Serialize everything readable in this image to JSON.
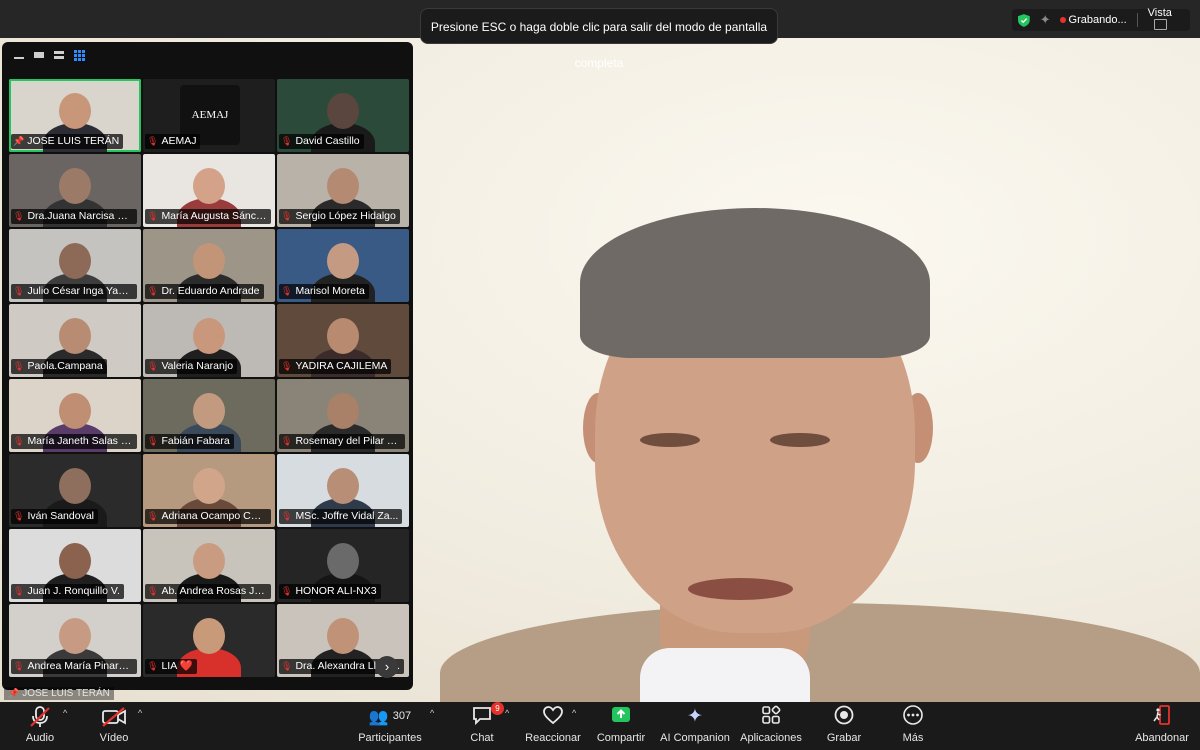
{
  "fullscreen_hint": "Presione ESC o haga doble clic para salir del modo de pantalla completa",
  "status": {
    "recording_label": "Grabando...",
    "view_label": "Vista"
  },
  "pinned_label": "JOSE LUIS TERÁN",
  "participants": [
    {
      "name": "JOSE LUIS TERÁN",
      "bg": "#d9d4cc",
      "skin": "#c89678",
      "shirt": "#2c2c34",
      "active": true,
      "pinned": true
    },
    {
      "name": "AEMAJ",
      "bg": "#1e1e1e",
      "logo": "AEMAJ",
      "muted": true
    },
    {
      "name": "David Castillo",
      "bg": "#2c4a3a",
      "skin": "#5a463e",
      "shirt": "#1a1a1a",
      "muted": true
    },
    {
      "name": "Dra.Juana Narcisa Pa...",
      "bg": "#6a6462",
      "skin": "#9b7b68",
      "shirt": "#333",
      "muted": true
    },
    {
      "name": "María Augusta Sánch...",
      "bg": "#e9e6e2",
      "skin": "#d4a288",
      "shirt": "#9a3c3c",
      "muted": true
    },
    {
      "name": "Sergio López Hidalgo",
      "bg": "#b8b2a8",
      "skin": "#b58a72",
      "shirt": "#2a2a2a",
      "muted": true
    },
    {
      "name": "Julio César Inga Yanza",
      "bg": "#c5c3c0",
      "skin": "#8d6a58",
      "shirt": "#3d3d3d",
      "muted": true
    },
    {
      "name": "Dr. Eduardo Andrade",
      "bg": "#9c9588",
      "skin": "#c29478",
      "shirt": "#2b2b2b",
      "muted": true
    },
    {
      "name": "Marisol Moreta",
      "bg": "#3a5a86",
      "skin": "#c49a82",
      "shirt": "#222",
      "muted": true
    },
    {
      "name": "Paola.Campana",
      "bg": "#cfcac4",
      "skin": "#b78c73",
      "shirt": "#2a2a2a",
      "muted": true
    },
    {
      "name": "Valeria Naranjo",
      "bg": "#bdbab5",
      "skin": "#c8977c",
      "shirt": "#1f1f1f",
      "muted": true
    },
    {
      "name": "YADIRA CAJILEMA",
      "bg": "#5f4a3c",
      "skin": "#b88a6f",
      "shirt": "#3b2b2b",
      "muted": true
    },
    {
      "name": "María Janeth Salas S...",
      "bg": "#dcd4c8",
      "skin": "#c08e72",
      "shirt": "#5a3c6a",
      "muted": true
    },
    {
      "name": "Fabián Fabara",
      "bg": "#6d6a5e",
      "skin": "#c29a80",
      "shirt": "#3a4a5a",
      "muted": true
    },
    {
      "name": "Rosemary del Pilar Te...",
      "bg": "#8a8478",
      "skin": "#a98068",
      "shirt": "#2a2a2a",
      "muted": true
    },
    {
      "name": "Iván Sandoval",
      "bg": "#2b2b2b",
      "skin": "#8e6e5c",
      "shirt": "#1a1a1a",
      "muted": true
    },
    {
      "name": "Adriana Ocampo Carbo",
      "bg": "#b59a80",
      "skin": "#d1a58a",
      "shirt": "#6a4a3a",
      "muted": true
    },
    {
      "name": "MSc. Joffre Vidal Za...",
      "bg": "#d6dce0",
      "skin": "#b88e76",
      "shirt": "#2f3a4a",
      "muted": true
    },
    {
      "name": "Juan J. Ronquillo V.",
      "bg": "#dcdcdc",
      "skin": "#8a624e",
      "shirt": "#1f1f1f",
      "muted": true
    },
    {
      "name": "Ab. Andrea Rosas Ju...",
      "bg": "#c8c4bc",
      "skin": "#c99c82",
      "shirt": "#1a1a1a",
      "muted": true
    },
    {
      "name": "HONOR ALI-NX3",
      "bg": "#252525",
      "skin": "#6a6a6a",
      "shirt": "#151515",
      "muted": true
    },
    {
      "name": "Andrea María Pinargo...",
      "bg": "#d3cfcb",
      "skin": "#c79b83",
      "shirt": "#3a3a3a",
      "muted": true
    },
    {
      "name": "LIA ❤️",
      "bg": "#2a2a2a",
      "skin": "#c99a7a",
      "shirt": "#d8312b",
      "muted": true
    },
    {
      "name": "Dra. Alexandra Llere...",
      "bg": "#c9c3bb",
      "skin": "#c09278",
      "shirt": "#222",
      "muted": true
    }
  ],
  "controls": {
    "audio": "Audio",
    "video": "Vídeo",
    "participants": "Participantes",
    "participants_count": "307",
    "chat": "Chat",
    "chat_badge": "9",
    "react": "Reaccionar",
    "share": "Compartir",
    "ai": "AI Companion",
    "apps": "Aplicaciones",
    "record": "Grabar",
    "more": "Más",
    "leave": "Abandonar"
  },
  "colors": {
    "accent": "#2d8cff",
    "active_border": "#22c55e",
    "mute": "#e5322d",
    "share": "#22c55e"
  }
}
